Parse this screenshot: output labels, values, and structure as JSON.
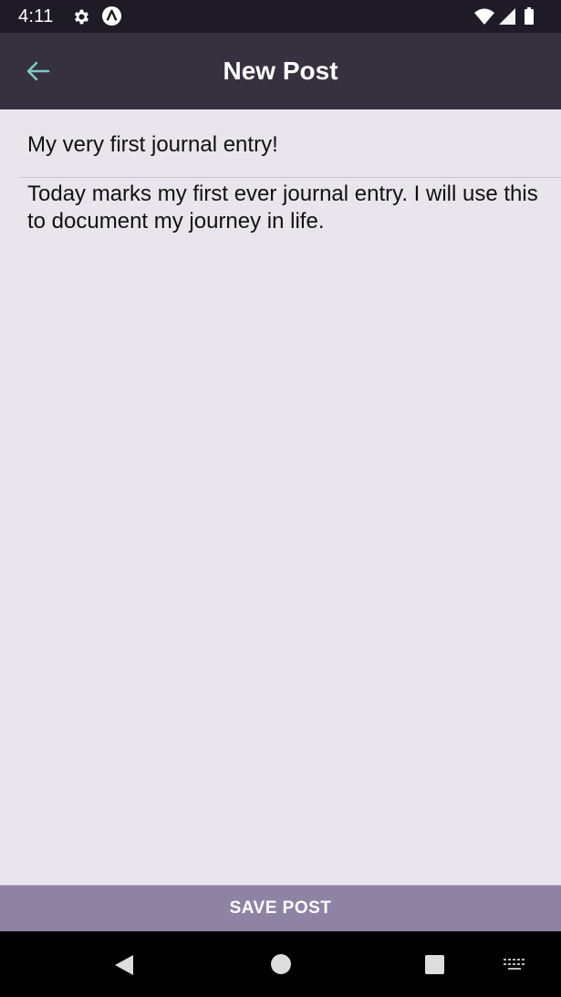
{
  "status_bar": {
    "time": "4:11",
    "icons": [
      "gear-icon",
      "app-notification-icon",
      "wifi-icon",
      "signal-icon",
      "battery-icon"
    ]
  },
  "app_bar": {
    "title": "New Post",
    "back_icon": "arrow-left-icon",
    "accent_color": "#7ec9c6"
  },
  "post": {
    "title_value": "My very first journal entry!",
    "body_value": "Today marks my first ever journal entry. I will use this to document my journey in life."
  },
  "actions": {
    "save_label": "SAVE POST"
  },
  "nav": {
    "icons": [
      "back-triangle-icon",
      "home-circle-icon",
      "recents-square-icon",
      "keyboard-icon"
    ]
  },
  "colors": {
    "status_bar": "#1e1b27",
    "app_bar": "#37303f",
    "background": "#e8e5ec",
    "save_button": "#8f83a3"
  }
}
